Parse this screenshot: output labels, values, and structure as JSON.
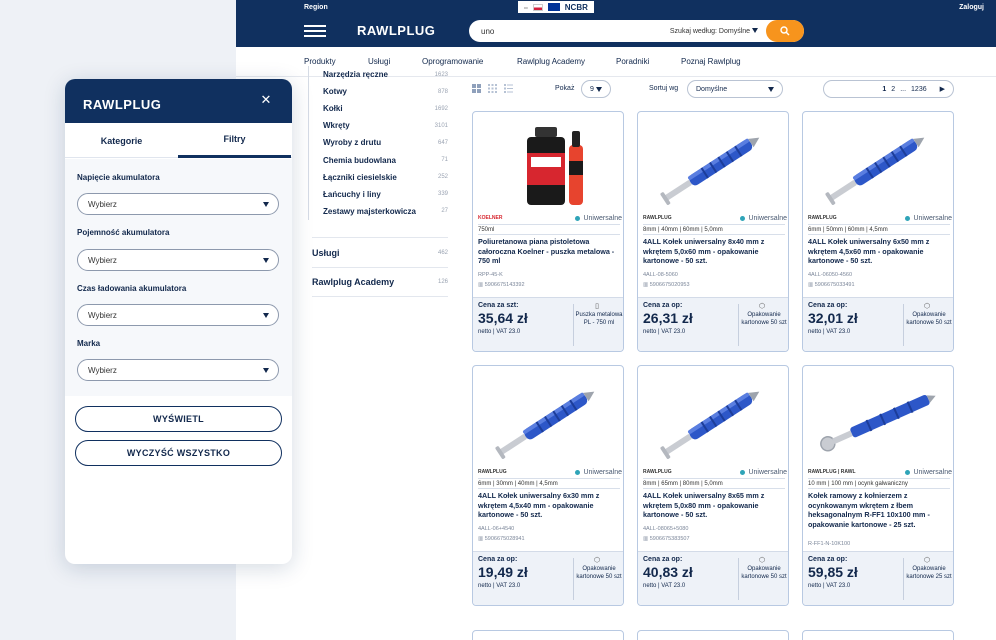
{
  "topbar": {
    "region": "Region",
    "login": "Zaloguj",
    "ncbr": "NCBR"
  },
  "header": {
    "logo": "RAWLPLUG",
    "search_value": "uno",
    "search_scope": "Szukaj według: Domyślne"
  },
  "nav": [
    "Produkty",
    "Usługi",
    "Oprogramowanie",
    "Rawlplug Academy",
    "Poradniki",
    "Poznaj Rawlplug"
  ],
  "categories": [
    {
      "label": "Narzędzia ręczne",
      "count": "1623"
    },
    {
      "label": "Kotwy",
      "count": "878"
    },
    {
      "label": "Kołki",
      "count": "1692"
    },
    {
      "label": "Wkręty",
      "count": "3101"
    },
    {
      "label": "Wyroby z drutu",
      "count": "647"
    },
    {
      "label": "Chemia budowlana",
      "count": "71"
    },
    {
      "label": "Łączniki ciesielskie",
      "count": "252"
    },
    {
      "label": "Łańcuchy i liny",
      "count": "339"
    },
    {
      "label": "Zestawy majsterkowicza",
      "count": "27"
    }
  ],
  "big_categories": [
    {
      "label": "Usługi",
      "count": "462"
    },
    {
      "label": "Rawlplug Academy",
      "count": "126"
    }
  ],
  "toolbar": {
    "show_label": "Pokaż",
    "show_value": "9",
    "sort_label": "Sortuj wg",
    "sort_value": "Domyślne",
    "pages": [
      "1",
      "2",
      "...",
      "1236"
    ]
  },
  "products": [
    {
      "brand": "KOELNER",
      "badge": "Uniwersalne",
      "specs": "750ml",
      "title": "Poliuretanowa piana pistoletowa całoroczna Koelner - puszka metalowa - 750 ml",
      "sku": "RPP-45-K",
      "ean": "5906675143392",
      "price_label": "Cena za szt:",
      "price": "35,64 zł",
      "vat": "netto | VAT 23.0",
      "pack": "Puszka metalowa PL - 750 ml",
      "kind": "foam"
    },
    {
      "brand": "RAWLPLUG",
      "badge": "Uniwersalne",
      "specs": "8mm | 40mm | 60mm | 5,0mm",
      "title": "4ALL Kołek uniwersalny 8x40 mm z wkrętem 5,0x60 mm - opakowanie kartonowe - 50 szt.",
      "sku": "4ALL-08-5060",
      "ean": "5906675020953",
      "price_label": "Cena za op:",
      "price": "26,31 zł",
      "vat": "netto | VAT 23.0",
      "pack": "Opakowanie kartonowe 50 szt",
      "kind": "anchor"
    },
    {
      "brand": "RAWLPLUG",
      "badge": "Uniwersalne",
      "specs": "6mm | 50mm | 60mm | 4,5mm",
      "title": "4ALL Kołek uniwersalny 6x50 mm z wkrętem 4,5x60 mm - opakowanie kartonowe - 50 szt.",
      "sku": "4ALL-06050-4560",
      "ean": "5906675033491",
      "price_label": "Cena za op:",
      "price": "32,01 zł",
      "vat": "netto | VAT 23.0",
      "pack": "Opakowanie kartonowe 50 szt",
      "kind": "anchor"
    },
    {
      "brand": "RAWLPLUG",
      "badge": "Uniwersalne",
      "specs": "6mm | 30mm | 40mm | 4,5mm",
      "title": "4ALL Kołek uniwersalny 6x30 mm z wkrętem 4,5x40 mm - opakowanie kartonowe - 50 szt.",
      "sku": "4ALL-06+4540",
      "ean": "5906675028941",
      "price_label": "Cena za op:",
      "price": "19,49 zł",
      "vat": "netto | VAT 23.0",
      "pack": "Opakowanie kartonowe 50 szt",
      "kind": "anchor"
    },
    {
      "brand": "RAWLPLUG",
      "badge": "Uniwersalne",
      "specs": "8mm | 65mm | 80mm | 5,0mm",
      "title": "4ALL Kołek uniwersalny 8x65 mm z wkrętem 5,0x80 mm - opakowanie kartonowe - 50 szt.",
      "sku": "4ALL-08065+5080",
      "ean": "5906675383507",
      "price_label": "Cena za op:",
      "price": "40,83 zł",
      "vat": "netto | VAT 23.0",
      "pack": "Opakowanie kartonowe 50 szt",
      "kind": "anchor"
    },
    {
      "brand": "RAWLPLUG | RAWL",
      "badge": "Uniwersalne",
      "specs": "10 mm | 100 mm | ocynk galwaniczny",
      "title": "Kołek ramowy z kołnierzem z ocynkowanym wkrętem z łbem heksagonalnym R-FF1 10x100 mm - opakowanie kartonowe - 25 szt.",
      "sku": "R-FF1-N-10K100",
      "ean": "5906675266992",
      "price_label": "Cena za op:",
      "price": "59,85 zł",
      "vat": "netto | VAT 23.0",
      "pack": "Opakowanie kartonowe 25 szt",
      "kind": "frame"
    }
  ],
  "modal": {
    "logo": "RAWLPLUG",
    "tab_categories": "Kategorie",
    "tab_filters": "Filtry",
    "filters": [
      {
        "label": "Napięcie akumulatora",
        "value": "Wybierz"
      },
      {
        "label": "Pojemność akumulatora",
        "value": "Wybierz"
      },
      {
        "label": "Czas ładowania akumulatora",
        "value": "Wybierz"
      },
      {
        "label": "Marka",
        "value": "Wybierz"
      }
    ],
    "show_button": "WYŚWIETL",
    "clear_button": "WYCZYŚĆ WSZYSTKO"
  },
  "colors": {
    "navy": "#10305f",
    "orange": "#f7941d",
    "blue_plug": "#2d57c8",
    "teal": "#2fa4b8"
  }
}
